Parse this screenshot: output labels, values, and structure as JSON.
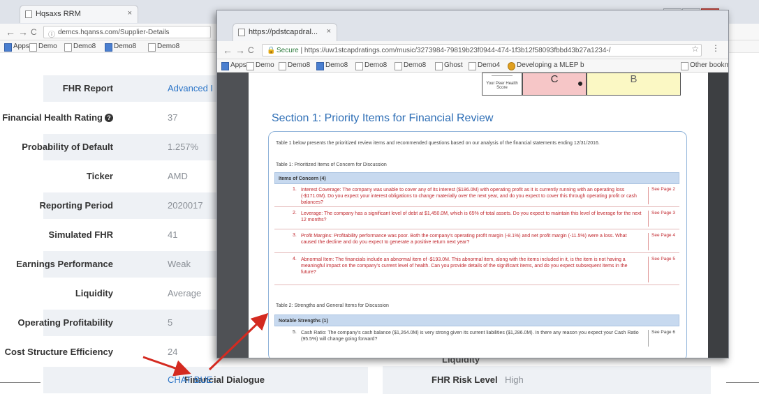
{
  "back_browser": {
    "tab_title": "Hqsaxs RRM",
    "tab_close": "×",
    "url": "demcs.hqanss.com/Supplier-Details",
    "nav": {
      "back": "←",
      "forward": "→",
      "reload": "C"
    },
    "bookmarks": [
      "Apps",
      "Demo",
      "Demo8",
      "Demo8",
      "Demo8"
    ]
  },
  "window_controls": {
    "minimize": "–",
    "maximize": "▭",
    "close": "✕"
  },
  "details": {
    "rows": [
      {
        "label": "FHR Report",
        "value": "Advanced I"
      },
      {
        "label": "Financial Health Rating",
        "value": "37"
      },
      {
        "label": "Probability of Default",
        "value": "1.257%"
      },
      {
        "label": "Ticker",
        "value": "AMD"
      },
      {
        "label": "Reporting Period",
        "value": "2020017"
      },
      {
        "label": "Simulated FHR",
        "value": "41"
      },
      {
        "label": "Earnings Performance",
        "value": "Weak"
      },
      {
        "label": "Liquidity",
        "value": "Average"
      },
      {
        "label": "Operating Profitability",
        "value": "5"
      },
      {
        "label": "Cost Structure Efficiency",
        "value": "24"
      },
      {
        "label": "Financial Dialogue",
        "value": "CHAT BUE"
      }
    ],
    "info_icon": "?",
    "right_partial": "Liquidity",
    "fhr_risk": {
      "label": "FHR Risk Level",
      "value": "High"
    }
  },
  "popup": {
    "tab_title": "https://pdstcapdral...",
    "tab_close": "×",
    "url_secure": "Secure",
    "url": "https://uw1stcapdratings.com/music/3273984-79819b23f0944-474-1f3b12f58093fbbd43b27a1234-/",
    "bookmarks": [
      "Apps",
      "Demo",
      "Demo8",
      "Demo8",
      "Demo8",
      "Demo8",
      "Ghost",
      "Demo4",
      "Developing a MLEP b"
    ],
    "bookmarks_right": "Other bookma",
    "star": "☆",
    "menu": "⋮",
    "grade_table": {
      "mini_top": "—————",
      "mini_label": "Your Peer Health Score",
      "grade_c": "C",
      "grade_b": "B"
    },
    "section_title": "Section 1: Priority Items for Financial Review",
    "intro": "Table 1 below presents the prioritized review items and recommended questions based on our analysis of the financial statements ending 12/31/2016.",
    "table1_caption": "Table 1: Prioritized Items of Concern for Discussion",
    "table1_header": "Items of Concern (4)",
    "concerns": [
      {
        "num": "1.",
        "text": "Interest Coverage: The company was unable to cover any of its interest ($186.0M) with operating profit as it is currently running with an operating loss (-$171.0M). Do you expect your interest obligations to change materially over the next year, and do you expect to cover this through operating profit or cash balances?",
        "ref": "See Page 2"
      },
      {
        "num": "2.",
        "text": "Leverage: The company has a significant level of debt at $1,450.0M, which is 65% of total assets. Do you expect to maintain this level of leverage for the next 12 months?",
        "ref": "See Page 3"
      },
      {
        "num": "3.",
        "text": "Profit Margins: Profitability performance was poor. Both the company's operating profit margin (-8.1%) and net profit margin (-11.5%) were a loss. What caused the decline and do you expect to generate a positive return next year?",
        "ref": "See Page 4"
      },
      {
        "num": "4.",
        "text": "Abnormal Item: The financials include an abnormal item of -$193.0M. This abnormal item, along with the items included in it, is the item is not having a meaningful impact on the company's current level of health. Can you provide details of the significant items, and do you expect subsequent items in the future?",
        "ref": "See Page 5"
      }
    ],
    "table2_caption": "Table 2: Strengths and General Items for Discussion",
    "table2_header": "Notable Strengths (1)",
    "strengths": [
      {
        "num": "5.",
        "text": "Cash Ratio: The company's cash balance ($1,264.0M) is very strong given its current liabilities ($1,286.0M). In there any reason you expect your Cash Ratio (95.5%) will change going forward?",
        "ref": "See Page 6"
      }
    ]
  }
}
